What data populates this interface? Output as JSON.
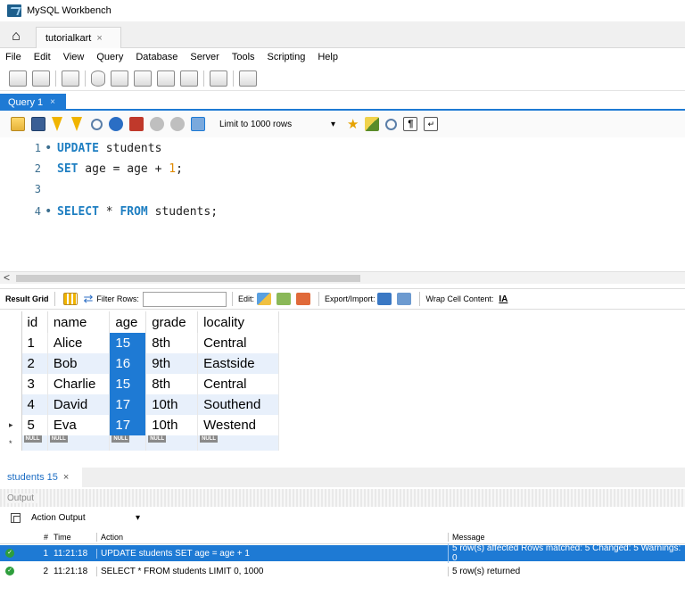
{
  "app": {
    "title": "MySQL Workbench"
  },
  "connection_tab": {
    "label": "tutorialkart",
    "close": "×"
  },
  "menu": [
    "File",
    "Edit",
    "View",
    "Query",
    "Database",
    "Server",
    "Tools",
    "Scripting",
    "Help"
  ],
  "query_tab": {
    "label": "Query 1",
    "close": "×"
  },
  "sql_toolbar": {
    "limit_label": "Limit to 1000 rows",
    "limit_arrow": "▾"
  },
  "editor": {
    "lines": [
      {
        "num": "1",
        "marker": "•"
      },
      {
        "num": "2",
        "marker": ""
      },
      {
        "num": "3",
        "marker": ""
      },
      {
        "num": "4",
        "marker": "•"
      }
    ],
    "tokens": {
      "l1_kw": "UPDATE",
      "l1_rest": " students",
      "l2_kw": "SET",
      "l2_rest": " age = age + ",
      "l2_num": "1",
      "l2_end": ";",
      "l4_kw1": "SELECT",
      "l4_mid": " * ",
      "l4_kw2": "FROM",
      "l4_rest": " students;"
    }
  },
  "scroll": {
    "left_arrow": "<"
  },
  "result_toolbar": {
    "result_grid": "Result Grid",
    "filter_rows": "Filter Rows:",
    "edit": "Edit:",
    "export_import": "Export/Import:",
    "wrap_cell": "Wrap Cell Content:",
    "wrap_icon": "IA"
  },
  "grid": {
    "columns": [
      "id",
      "name",
      "age",
      "grade",
      "locality"
    ],
    "rows": [
      {
        "id": "1",
        "name": "Alice",
        "age": "15",
        "grade": "8th",
        "locality": "Central"
      },
      {
        "id": "2",
        "name": "Bob",
        "age": "16",
        "grade": "9th",
        "locality": "Eastside"
      },
      {
        "id": "3",
        "name": "Charlie",
        "age": "15",
        "grade": "8th",
        "locality": "Central"
      },
      {
        "id": "4",
        "name": "David",
        "age": "17",
        "grade": "10th",
        "locality": "Southend"
      },
      {
        "id": "5",
        "name": "Eva",
        "age": "17",
        "grade": "10th",
        "locality": "Westend"
      }
    ],
    "current_row_marker": "▸",
    "new_row_marker": "*",
    "null_label": "NULL"
  },
  "result_tab": {
    "label": "students 15",
    "close": "×"
  },
  "output": {
    "header": "Output",
    "selector": "Action Output",
    "selector_arrow": "▾",
    "columns": {
      "num": "#",
      "time": "Time",
      "action": "Action",
      "message": "Message"
    },
    "rows": [
      {
        "num": "1",
        "time": "11:21:18",
        "action": "UPDATE students SET age = age + 1",
        "message": "5 row(s) affected Rows matched: 5  Changed: 5  Warnings: 0"
      },
      {
        "num": "2",
        "time": "11:21:18",
        "action": "SELECT * FROM students LIMIT 0, 1000",
        "message": "5 row(s) returned"
      }
    ],
    "ok_glyph": "✓"
  },
  "colors": {
    "accent": "#1e7ad4",
    "keyword": "#1f7fc2",
    "number": "#e08a00",
    "ok": "#2e9e3c",
    "row_alt": "#e8f0fb"
  }
}
